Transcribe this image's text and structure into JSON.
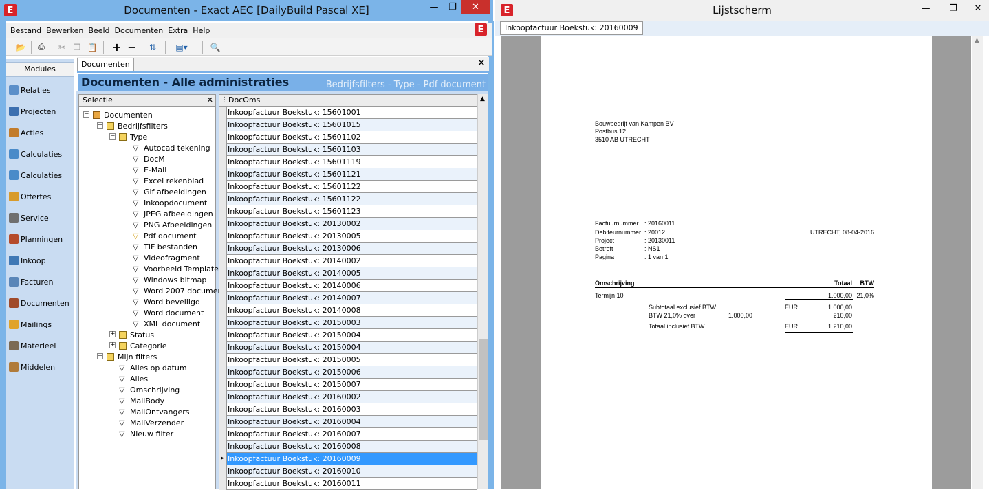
{
  "main_window": {
    "title": "Documenten - Exact AEC [DailyBuild Pascal XE]",
    "logo": "E"
  },
  "menu": [
    "Bestand",
    "Bewerken",
    "Beeld",
    "Documenten",
    "Extra",
    "Help"
  ],
  "modules": {
    "header": "Modules",
    "items": [
      "Relaties",
      "Projecten",
      "Acties",
      "Calculaties",
      "Calculaties",
      "Offertes",
      "Service",
      "Planningen",
      "Inkoop",
      "Facturen",
      "Documenten",
      "Mailings",
      "Materieel",
      "Middelen"
    ]
  },
  "doc_tab": "Documenten",
  "banner": {
    "title": "Documenten - Alle administraties",
    "subtitle": "Bedrijfsfilters - Type - Pdf document"
  },
  "selection": {
    "header": "Selectie",
    "root": "Documenten",
    "bedrijfsfilters": "Bedrijfsfilters",
    "type": "Type",
    "types": [
      "Autocad tekening",
      "DocM",
      "E-Mail",
      "Excel rekenblad",
      "Gif afbeeldingen",
      "Inkoopdocument",
      "JPEG afbeeldingen",
      "PNG Afbeeldingen",
      "Pdf document",
      "TIF bestanden",
      "Videofragment",
      "Voorbeeld Template",
      "Windows bitmap",
      "Word 2007 documen",
      "Word beveiligd",
      "Word document",
      "XML document"
    ],
    "status": "Status",
    "categorie": "Categorie",
    "mijn_filters": "Mijn filters",
    "my_filters": [
      "Alles op datum",
      "Alles",
      "Omschrijving",
      "MailBody",
      "MailOntvangers",
      "MailVerzender",
      "Nieuw filter"
    ]
  },
  "list": {
    "column": "DocOms",
    "rows": [
      "Inkoopfactuur Boekstuk: 15601001",
      "Inkoopfactuur Boekstuk: 15601015",
      "Inkoopfactuur Boekstuk: 15601102",
      "Inkoopfactuur Boekstuk: 15601103",
      "Inkoopfactuur Boekstuk: 15601119",
      "Inkoopfactuur Boekstuk: 15601121",
      "Inkoopfactuur Boekstuk: 15601122",
      "Inkoopfactuur Boekstuk: 15601122",
      "Inkoopfactuur Boekstuk: 15601123",
      "Inkoopfactuur Boekstuk: 20130002",
      "Inkoopfactuur Boekstuk: 20130005",
      "Inkoopfactuur Boekstuk: 20130006",
      "Inkoopfactuur Boekstuk: 20140002",
      "Inkoopfactuur Boekstuk: 20140005",
      "Inkoopfactuur Boekstuk: 20140006",
      "Inkoopfactuur Boekstuk: 20140007",
      "Inkoopfactuur Boekstuk: 20140008",
      "Inkoopfactuur Boekstuk: 20150003",
      "Inkoopfactuur Boekstuk: 20150004",
      "Inkoopfactuur Boekstuk: 20150004",
      "Inkoopfactuur Boekstuk: 20150005",
      "Inkoopfactuur Boekstuk: 20150006",
      "Inkoopfactuur Boekstuk: 20150007",
      "Inkoopfactuur Boekstuk: 20160002",
      "Inkoopfactuur Boekstuk: 20160003",
      "Inkoopfactuur Boekstuk: 20160004",
      "Inkoopfactuur Boekstuk: 20160007",
      "Inkoopfactuur Boekstuk: 20160008",
      "Inkoopfactuur Boekstuk: 20160009",
      "Inkoopfactuur Boekstuk: 20160010",
      "Inkoopfactuur Boekstuk: 20160011"
    ],
    "selected_index": 28
  },
  "viewer": {
    "title": "Lijstscherm",
    "tab": "Inkoopfactuur Boekstuk: 20160009",
    "address": [
      "Bouwbedrijf van Kampen BV",
      "Postbus 12",
      "3510 AB  UTRECHT"
    ],
    "meta_labels": [
      "Factuurnummer",
      "Debiteurnummer",
      "Project",
      "Betreft",
      "Pagina"
    ],
    "meta_values": [
      ": 20160011",
      ": 20012",
      ": 20130011",
      ": NS1",
      ": 1 van 1"
    ],
    "place_date": "UTRECHT, 08-04-2016",
    "col_omschrijving": "Omschrijving",
    "col_totaal": "Totaal",
    "col_btw": "BTW",
    "line_desc": "Termijn 10",
    "line_amount": "1.000,00",
    "line_btw": "21,0%",
    "subtotal_label": "Subtotaal exclusief BTW",
    "subtotal_cur": "EUR",
    "subtotal_amount": "1.000,00",
    "btw_label": "BTW   21,0%  over",
    "btw_base": "1.000,00",
    "btw_amount": "210,00",
    "total_label": "Totaal inclusief BTW",
    "total_cur": "EUR",
    "total_amount": "1.210,00"
  },
  "colors": {
    "accent": "#79b0e8",
    "selected": "#3399ff",
    "logo": "#d8232a",
    "close": "#c9302c"
  }
}
